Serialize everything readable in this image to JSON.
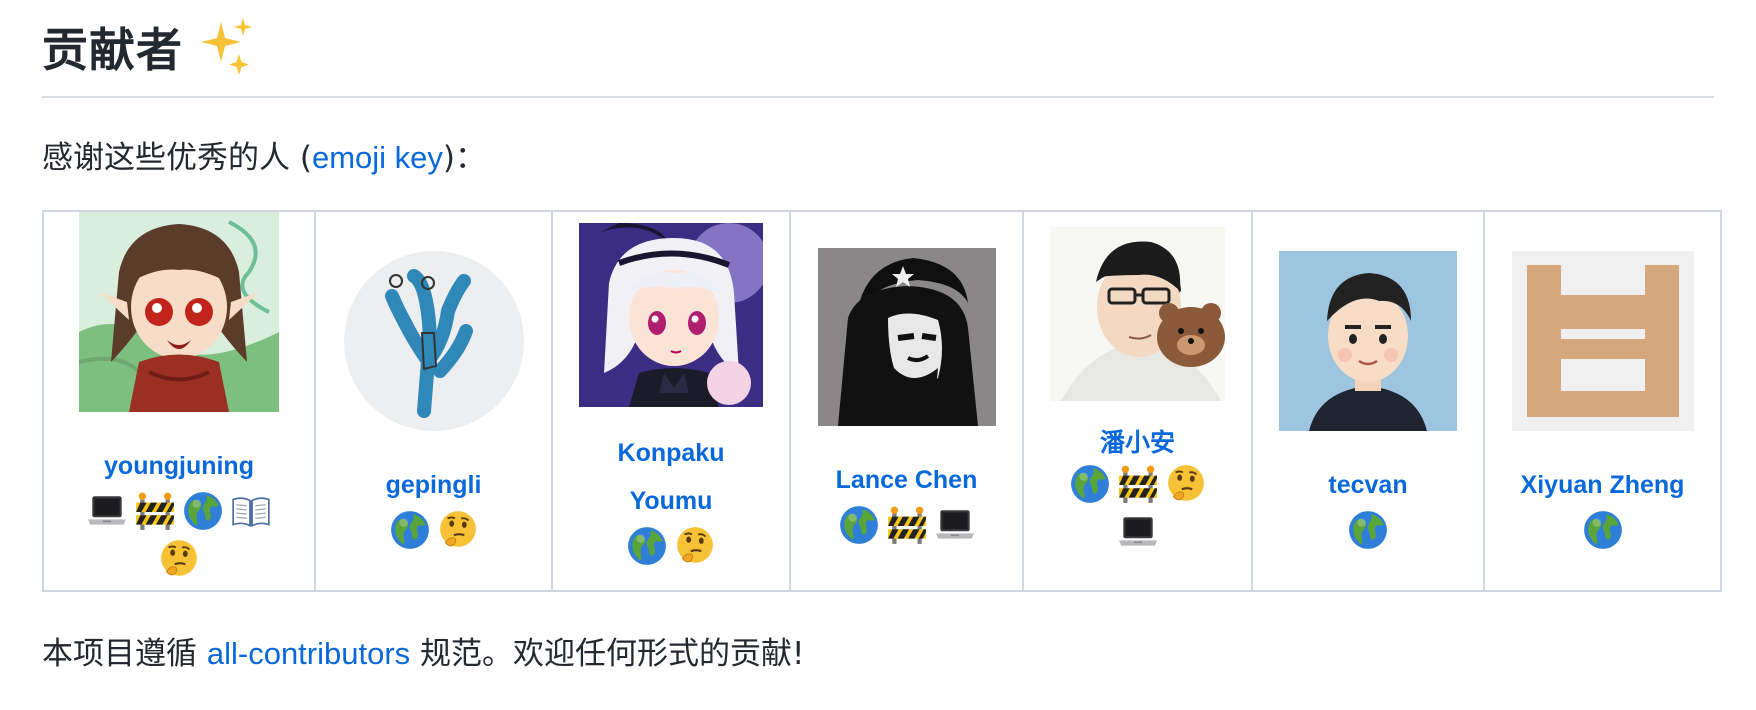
{
  "heading": {
    "title": "贡献者",
    "icon": "sparkles-icon"
  },
  "intro": {
    "prefix": "感谢这些优秀的人 (",
    "link_text": "emoji key",
    "suffix": ")："
  },
  "contributors": [
    {
      "name": "youngjuning",
      "badges": [
        "laptop",
        "construction",
        "globe",
        "book",
        "thinking"
      ]
    },
    {
      "name": "gepingli",
      "badges": [
        "globe",
        "thinking"
      ]
    },
    {
      "name": "Konpaku Youmu",
      "name_line1": "Konpaku",
      "name_line2": "Youmu",
      "badges": [
        "globe",
        "thinking"
      ]
    },
    {
      "name": "Lance Chen",
      "badges": [
        "globe",
        "construction",
        "laptop"
      ]
    },
    {
      "name": "潘小安",
      "badges": [
        "globe",
        "construction",
        "thinking",
        "laptop"
      ]
    },
    {
      "name": "tecvan",
      "badges": [
        "globe"
      ]
    },
    {
      "name": "Xiyuan Zheng",
      "badges": [
        "globe"
      ]
    }
  ],
  "footer": {
    "prefix": "本项目遵循 ",
    "link_text": "all-contributors",
    "suffix": " 规范。欢迎任何形式的贡献!"
  },
  "colors": {
    "link": "#0969da",
    "text": "#24292f",
    "border": "#d0d7de"
  }
}
